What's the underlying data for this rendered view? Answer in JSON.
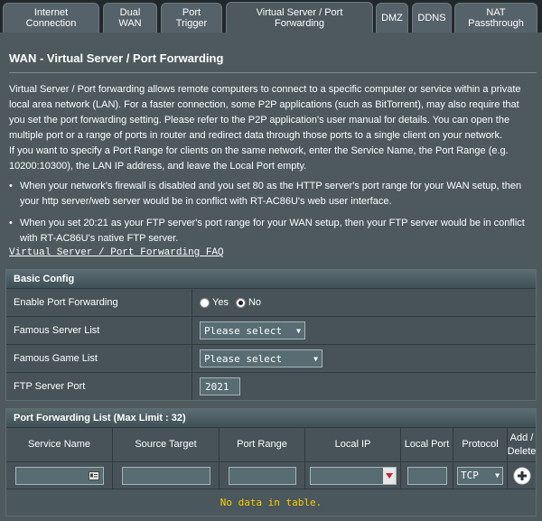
{
  "tabs": [
    {
      "label": "Internet\nConnection"
    },
    {
      "label": "Dual\nWAN"
    },
    {
      "label": "Port\nTrigger"
    },
    {
      "label": "Virtual Server / Port\nForwarding"
    },
    {
      "label": "DMZ"
    },
    {
      "label": "DDNS"
    },
    {
      "label": "NAT\nPassthrough"
    }
  ],
  "page": {
    "title": "WAN - Virtual Server / Port Forwarding",
    "description": "Virtual Server / Port forwarding allows remote computers to connect to a specific computer or service within a private local area network (LAN). For a faster connection, some P2P applications (such as BitTorrent), may also require that you set the port forwarding setting. Please refer to the P2P application's user manual for details. You can open the multiple port or a range of ports in router and redirect data through those ports to a single client on your network.",
    "description2": "If you want to specify a Port Range for clients on the same network, enter the Service Name, the Port Range (e.g. 10200:10300), the LAN IP address, and leave the Local Port empty.",
    "bullets": [
      "When your network's firewall is disabled and you set 80 as the HTTP server's port range for your WAN setup, then your http server/web server would be in conflict with RT-AC86U's web user interface.",
      "When you set 20:21 as your FTP server's port range for your WAN setup, then your FTP server would be in conflict with RT-AC86U's native FTP server."
    ],
    "faq_link": "Virtual Server / Port Forwarding FAQ"
  },
  "basic_config": {
    "header": "Basic Config",
    "enable_label": "Enable Port Forwarding",
    "yes_label": "Yes",
    "no_label": "No",
    "enable_value": "No",
    "famous_server_label": "Famous Server List",
    "famous_server_value": "Please select",
    "famous_game_label": "Famous Game List",
    "famous_game_value": "Please select",
    "ftp_port_label": "FTP Server Port",
    "ftp_port_value": "2021"
  },
  "forwarding_list": {
    "header": "Port Forwarding List (Max Limit : 32)",
    "columns": [
      "Service Name",
      "Source Target",
      "Port Range",
      "Local IP",
      "Local Port",
      "Protocol",
      "Add /\nDelete"
    ],
    "protocol_value": "TCP",
    "empty_text": "No data in table."
  },
  "colors": {
    "background": "#21282b",
    "panel": "#4d595d",
    "empty_text": "#ffcc00",
    "dropdown_arrow": "#c0272d"
  }
}
